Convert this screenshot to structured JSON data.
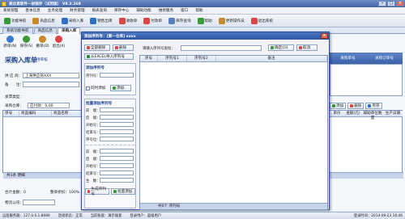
{
  "window": {
    "title": "美达思软件一进销存（试用版） V8.3.268"
  },
  "menu": [
    "系统管理",
    "基本信息",
    "业务处理",
    "财务管理",
    "报表查询",
    "库存中心",
    "辅助功能",
    "维修服务",
    "窗口",
    "帮助"
  ],
  "toolbar": [
    {
      "label": "功能导航",
      "icon": "compass-icon",
      "color": "#3a9a3a"
    },
    {
      "label": "商品信息",
      "icon": "box-icon",
      "color": "#c98a2a"
    },
    {
      "label": "采购入库",
      "icon": "cart-in-icon",
      "color": "#2f6fc4"
    },
    {
      "label": "销售出库",
      "icon": "cart-out-icon",
      "color": "#2f6fc4"
    },
    {
      "label": "收款单",
      "icon": "money-icon",
      "color": "#d44"
    },
    {
      "label": "付款单",
      "icon": "pay-icon",
      "color": "#d44"
    },
    {
      "label": "库存查询",
      "icon": "search-icon",
      "color": "#5a7fbf"
    },
    {
      "label": "帮助",
      "icon": "help-icon",
      "color": "#3a9a3a"
    },
    {
      "label": "更新操作员",
      "icon": "user-icon",
      "color": "#c98a2a"
    },
    {
      "label": "退出系统",
      "icon": "exit-icon",
      "color": "#d44"
    }
  ],
  "tabs": [
    "系统功能导航",
    "商品信息",
    "采购入库"
  ],
  "form": {
    "big_buttons": [
      "新单(N)",
      "保存(S)",
      "撤单(D)",
      "退出(X)"
    ],
    "title": "采购入库单",
    "subtitle": "待审核",
    "supplier_label": "供 应 商：",
    "supplier_value": "上海供应商XXX",
    "remark_label": "备　　注：",
    "extra_label": "发票类型：",
    "warehouse_label": "采购仓库：",
    "points_label": "应付款：0.00",
    "pay_label": "应付款：",
    "right_btns": [
      "添加",
      "删除",
      "另存"
    ],
    "grid_headers": [
      "序号",
      "商品编码",
      "商品名称"
    ],
    "right_headers": [
      "单价",
      "金额(元)",
      "辅助单位数量",
      "生产日期"
    ],
    "summary": "共1条 明细",
    "right_grid": [
      "采购单号",
      "采购订单号"
    ],
    "footer": {
      "total_label": "合计金额：0",
      "discount_label": "整单折扣：100%",
      "total2": "物流公司：",
      "fee_label": "货运单号：",
      "freight_label": "物流运费：0.0000",
      "sep": "已付运费",
      "cod_label": "物流代付运费：0.0000"
    }
  },
  "dialog": {
    "title": "添加序列号：[第一仓库]  xxxx",
    "btn_select_all": "全部删除",
    "btn_delete": "删除",
    "btn_excel": "从EXCEL导入序列号",
    "search_label": "请输入序列号查找：",
    "btn_ok": "确定(O)",
    "btn_cancel": "取消",
    "group1_title": "添加序列号",
    "group1_field": "序列号：",
    "chk_label": "同时添加",
    "btn_add": "添加",
    "group2_title": "批量添加序列号",
    "rows_a": [
      "前　缀：",
      "后　缀：",
      "开始号：",
      "结束号：",
      "序号位："
    ],
    "rows_b": [
      "前　缀：",
      "后　缀：",
      "开始号：",
      "结束号：",
      "生　数："
    ],
    "btn_create": "生成序列号",
    "btn_batch": "批量添加",
    "grid_headers": [
      "序号",
      "序列号1",
      "序列号2",
      "备注"
    ],
    "grid_footer": "共0个 序列号"
  },
  "status": {
    "db": "远程服务器：127.0.0.1:8089",
    "net": "连接状态：正常",
    "op": "当前账套：演示账套",
    "user": "登录用户：超级用户",
    "time": "登录时间：2014-09-23 16:46"
  }
}
